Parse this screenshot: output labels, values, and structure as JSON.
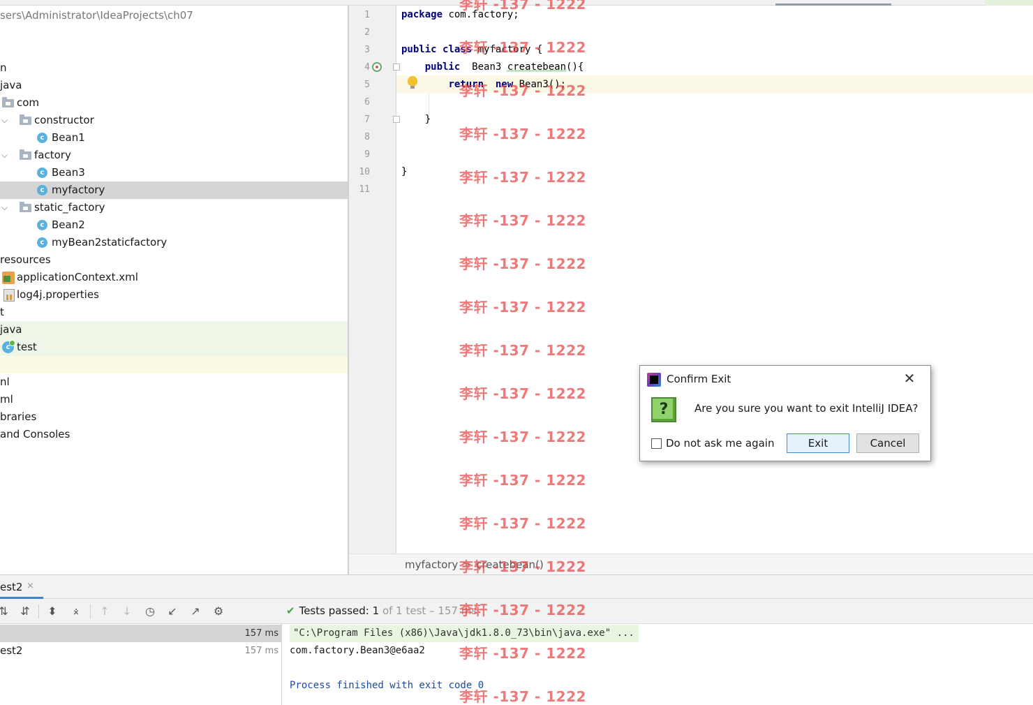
{
  "project_tree": {
    "path": "sers\\Administrator\\IdeaProjects\\ch07",
    "items": [
      {
        "label": "n"
      },
      {
        "label": "java"
      },
      {
        "label": "com"
      },
      {
        "label": "constructor"
      },
      {
        "label": "Bean1"
      },
      {
        "label": "factory"
      },
      {
        "label": "Bean3"
      },
      {
        "label": "myfactory"
      },
      {
        "label": "static_factory"
      },
      {
        "label": "Bean2"
      },
      {
        "label": "myBean2staticfactory"
      },
      {
        "label": "resources"
      },
      {
        "label": "applicationContext.xml"
      },
      {
        "label": "log4j.properties"
      },
      {
        "label": "t"
      },
      {
        "label": "java"
      },
      {
        "label": "test"
      },
      {
        "label": "nl"
      },
      {
        "label": "ml"
      },
      {
        "label": "braries"
      },
      {
        "label": "and Consoles"
      }
    ]
  },
  "editor": {
    "line_numbers": [
      "1",
      "2",
      "3",
      "4",
      "5",
      "6",
      "7",
      "8",
      "9",
      "10",
      "11"
    ],
    "code": {
      "l1_kw": "package",
      "l1_rest": " com.factory;",
      "l3_kw1": "public",
      "l3_kw2": "class",
      "l3_name": "myfactory",
      "l3_rest": " {",
      "l4_kw": "public",
      "l4_type": "  Bean3 ",
      "l4_name": "createbean",
      "l4_rest": "(){",
      "l5_kw1": "return",
      "l5_kw2": "new",
      "l5_rest": " Bean3();",
      "l7": "}",
      "l10": "}"
    },
    "breadcrumb": {
      "class_name": "myfactory",
      "separator": ">",
      "method_name": "createbean()"
    }
  },
  "run_panel": {
    "tab_label": "est2",
    "tab_close": "×",
    "status": {
      "prefix": "Tests passed: ",
      "passed": "1",
      "suffix": " of 1 test – 157 ms"
    },
    "tests": [
      {
        "label": "",
        "time": "157 ms"
      },
      {
        "label": "est2",
        "time": "157 ms"
      }
    ],
    "console": {
      "command": "\"C:\\Program Files (x86)\\Java\\jdk1.8.0_73\\bin\\java.exe\" ...",
      "output": "com.factory.Bean3@e6aa2",
      "finished": "Process finished with exit code 0"
    },
    "toolbar_icons": [
      "sort-alpha-icon",
      "sort-duration-icon",
      "expand-all-icon",
      "collapse-all-icon",
      "previous-failed-icon",
      "next-failed-icon",
      "history-icon",
      "import-icon",
      "export-icon",
      "settings-icon"
    ]
  },
  "watermark": {
    "text": "李轩 -137 - 1222"
  },
  "dialog": {
    "title": "Confirm Exit",
    "close": "✕",
    "question_mark": "?",
    "message": "Are you sure you want to exit IntelliJ IDEA?",
    "checkbox_label": "Do not ask me again",
    "exit_label": "Exit",
    "cancel_label": "Cancel"
  },
  "colors": {
    "keyword": "#000080",
    "selection": "#d5d5d5",
    "watermark": "#e64646",
    "console_blue": "#1b49a6",
    "pass_green": "#4a9e4a"
  }
}
